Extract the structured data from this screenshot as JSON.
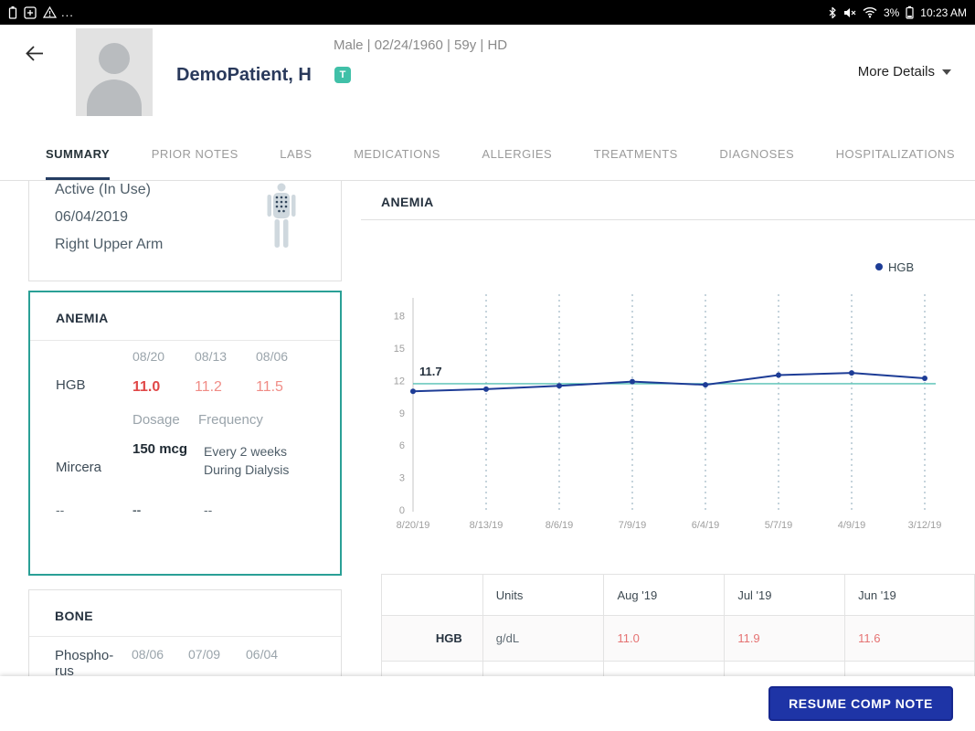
{
  "status_bar": {
    "time": "10:23 AM",
    "battery_percent": "3%",
    "overflow": "...",
    "left_icons": [
      "battery-outline-icon",
      "add-box-icon",
      "warning-icon"
    ],
    "right_icons": [
      "bluetooth-icon",
      "volume-mute-icon",
      "wifi-icon",
      "battery-icon"
    ]
  },
  "header": {
    "patient_name": "DemoPatient, H",
    "badge": "T",
    "demographics": "Male | 02/24/1960 | 59y  | HD",
    "more_details": "More Details"
  },
  "tabs": [
    {
      "label": "SUMMARY",
      "active": true
    },
    {
      "label": "PRIOR NOTES",
      "active": false
    },
    {
      "label": "LABS",
      "active": false
    },
    {
      "label": "MEDICATIONS",
      "active": false
    },
    {
      "label": "ALLERGIES",
      "active": false
    },
    {
      "label": "TREATMENTS",
      "active": false
    },
    {
      "label": "DIAGNOSES",
      "active": false
    },
    {
      "label": "HOSPITALIZATIONS",
      "active": false
    }
  ],
  "left_panel": {
    "access_card": {
      "lines": [
        "Active (In Use)",
        "06/04/2019",
        "Right Upper Arm"
      ]
    },
    "anemia_card": {
      "title": "ANEMIA",
      "dates": [
        "08/20",
        "08/13",
        "08/06"
      ],
      "hgb_label": "HGB",
      "hgb_values": [
        "11.0",
        "11.2",
        "11.5"
      ],
      "dosage_header": "Dosage",
      "frequency_header": "Frequency",
      "med_label": "Mircera",
      "dosage_value": "150 mcg",
      "frequency_line1": "Every 2 weeks",
      "frequency_line2": "During Dialysis",
      "empty": "--"
    },
    "bone_card": {
      "title": "BONE",
      "row_label_line1": "Phospho-",
      "row_label_line2": "rus",
      "dates": [
        "08/06",
        "07/09",
        "06/04"
      ]
    }
  },
  "main": {
    "section_title": "ANEMIA",
    "results_table": {
      "headers": [
        "",
        "Units",
        "Aug '19",
        "Jul '19",
        "Jun '19"
      ],
      "rows": [
        {
          "label": "HGB",
          "units": "g/dL",
          "values": [
            "11.0",
            "11.9",
            "11.6"
          ]
        }
      ]
    }
  },
  "chart_data": {
    "type": "line",
    "title": "ANEMIA",
    "categories": [
      "8/20/19",
      "8/13/19",
      "8/6/19",
      "7/9/19",
      "6/4/19",
      "5/7/19",
      "4/9/19",
      "3/12/19"
    ],
    "series": [
      {
        "name": "HGB",
        "values": [
          11.0,
          11.2,
          11.5,
          11.9,
          11.6,
          12.5,
          12.7,
          12.2
        ]
      }
    ],
    "y_ticks": [
      0,
      3,
      6,
      9,
      12,
      15,
      18
    ],
    "ylim": [
      0,
      19
    ],
    "x_order": "newest-first",
    "grid": "vertical-dotted",
    "legend_position": "top-right",
    "reference_line": {
      "value": 11.7,
      "label": "11.7",
      "color": "#53c0b4"
    },
    "line_color": "#1d3c96"
  },
  "footer": {
    "resume_label": "RESUME COMP NOTE"
  },
  "colors": {
    "accent_teal": "#2aa096",
    "navy": "#29395b",
    "red_strong": "#e04848",
    "red_light": "#f08c86",
    "table_red": "#e57373",
    "button_blue": "#1e34a6"
  }
}
